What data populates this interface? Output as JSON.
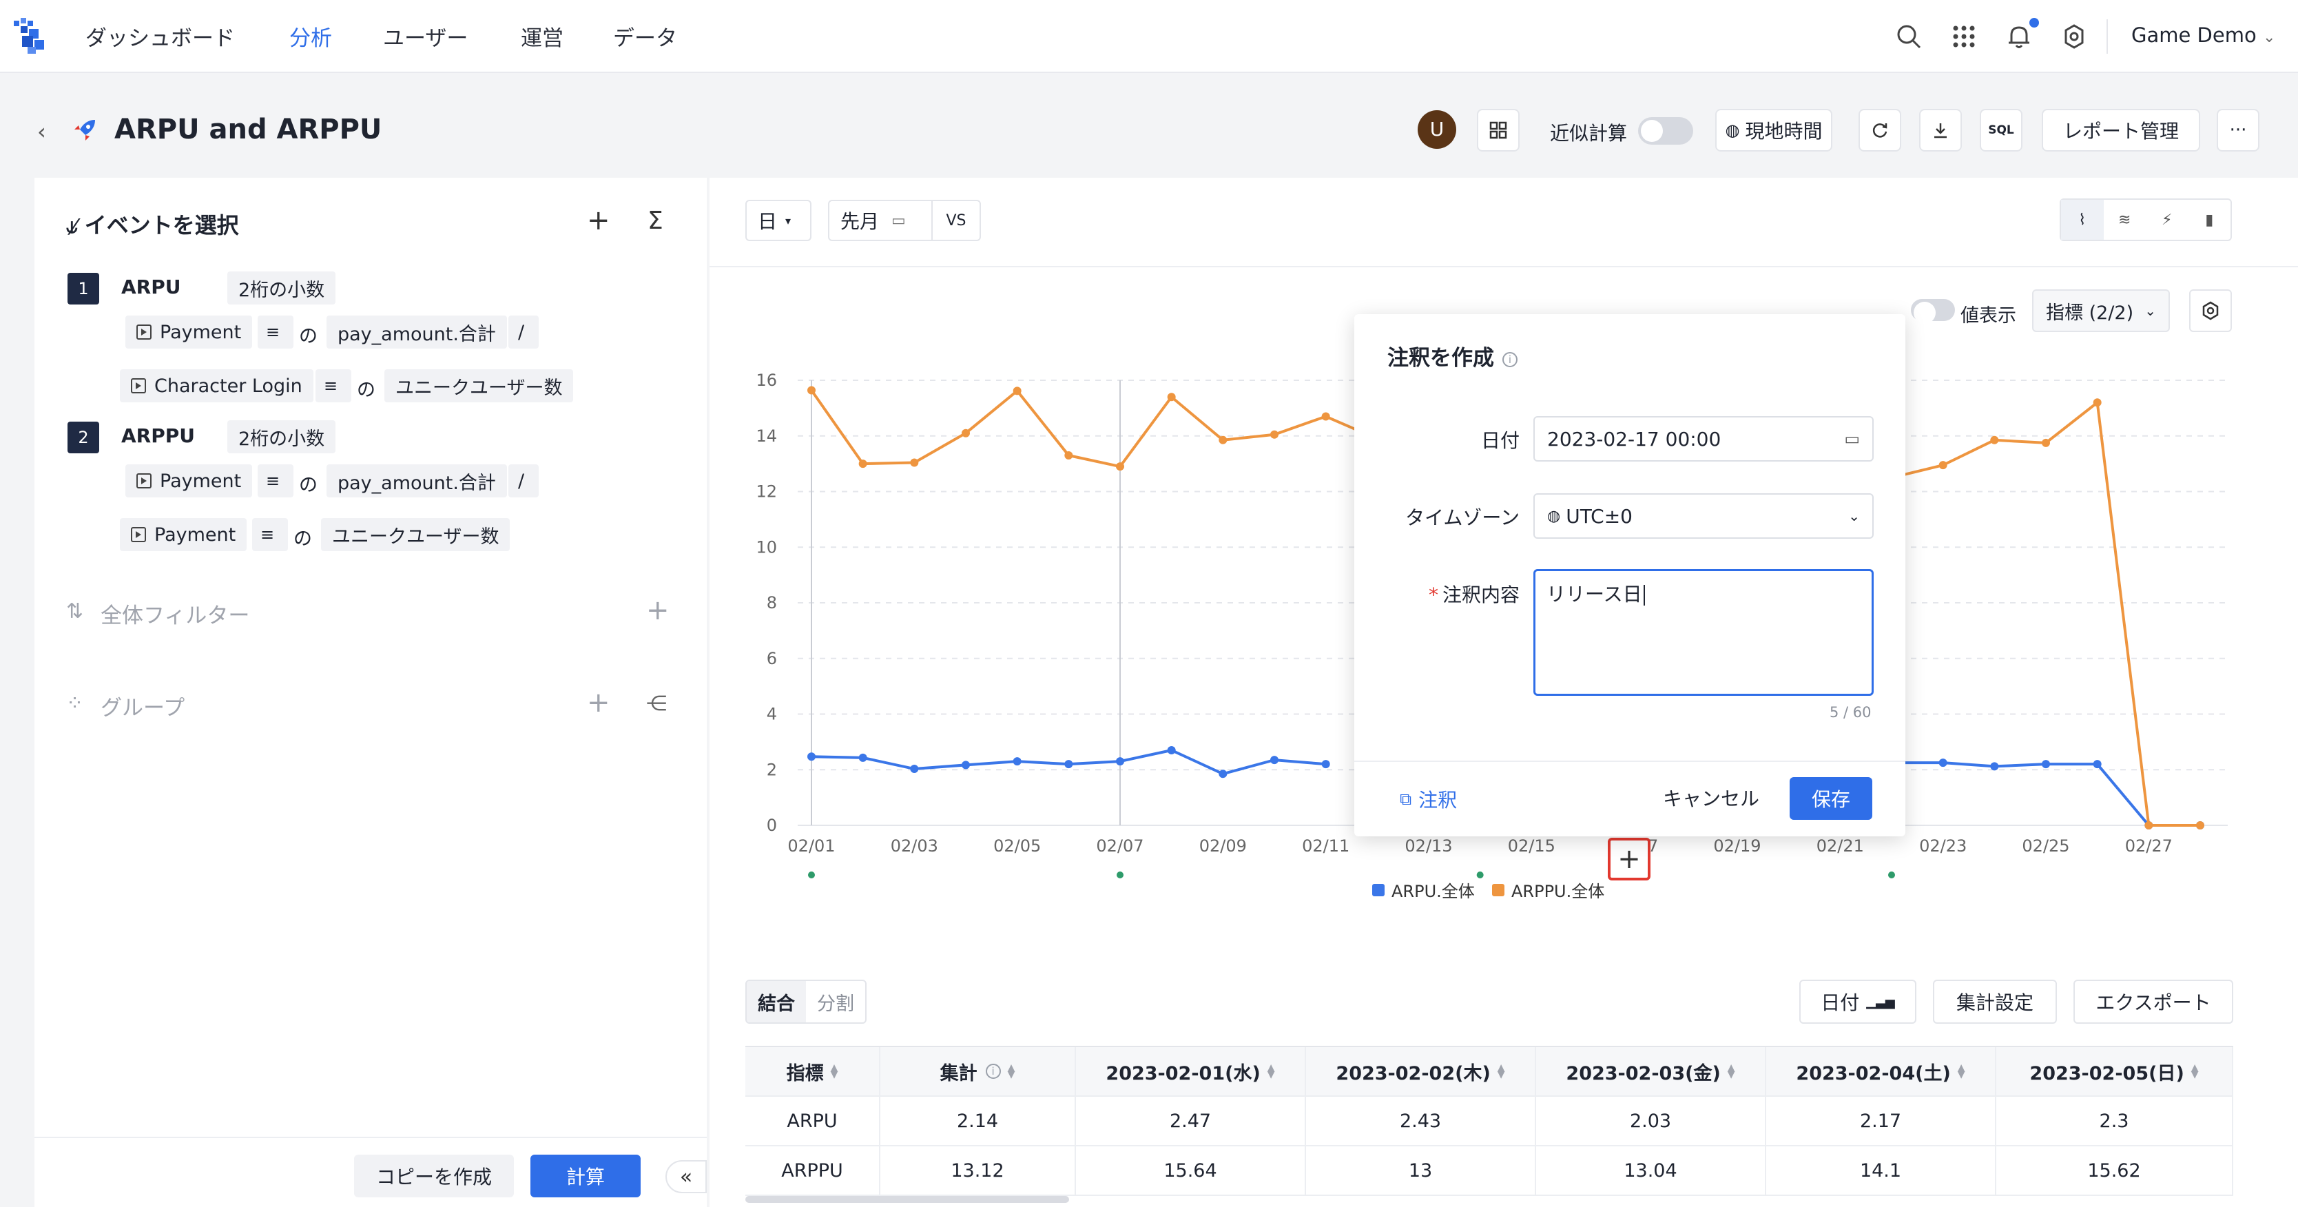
{
  "nav": {
    "items": [
      "ダッシュボード",
      "分析",
      "ユーザー",
      "運営",
      "データ"
    ],
    "active_index": 1,
    "project": "Game Demo"
  },
  "header": {
    "title": "ARPU and ARPPU",
    "avatar_letter": "U",
    "approx_label": "近似計算",
    "local_time": "現地時間",
    "sql": "SQL",
    "report_mgmt": "レポート管理",
    "more": "···"
  },
  "left": {
    "title": "イベントを選択",
    "metrics": [
      {
        "index": "1",
        "name": "ARPU",
        "decimal": "2桁の小数",
        "line1": {
          "event": "Payment",
          "no": "の",
          "prop": "pay_amount.合計",
          "op": "/"
        },
        "line2": {
          "event": "Character Login",
          "no": "の",
          "prop": "ユニークユーザー数"
        }
      },
      {
        "index": "2",
        "name": "ARPPU",
        "decimal": "2桁の小数",
        "line1": {
          "event": "Payment",
          "no": "の",
          "prop": "pay_amount.合計",
          "op": "/"
        },
        "line2": {
          "event": "Payment",
          "no": "の",
          "prop": "ユニークユーザー数"
        }
      }
    ],
    "global_filter": "全体フィルター",
    "group": "グループ",
    "copy_btn": "コピーを作成",
    "calc_btn": "計算",
    "collapse": "«"
  },
  "toolbar": {
    "granularity": "日",
    "period": "先月",
    "vs": "VS",
    "value_display": "値表示",
    "metric_select": "指標 (2/2)"
  },
  "chart_data": {
    "type": "line",
    "x": [
      "02/01",
      "02/02",
      "02/03",
      "02/04",
      "02/05",
      "02/06",
      "02/07",
      "02/08",
      "02/09",
      "02/10",
      "02/11",
      "02/12",
      "02/13",
      "02/14",
      "02/15",
      "02/16",
      "02/17",
      "02/18",
      "02/19",
      "02/20",
      "02/21",
      "02/22",
      "02/23",
      "02/24",
      "02/25",
      "02/26",
      "02/27",
      "02/28"
    ],
    "x_tick_labels": [
      "02/01",
      "02/03",
      "02/05",
      "02/07",
      "02/09",
      "02/11",
      "02/13",
      "02/15",
      "02/17",
      "02/19",
      "02/21",
      "02/23",
      "02/25",
      "02/27"
    ],
    "ylim": [
      0,
      16
    ],
    "y_ticks": [
      "0",
      "2",
      "4",
      "6",
      "8",
      "10",
      "12",
      "14",
      "16"
    ],
    "series": [
      {
        "name": "ARPU.全体",
        "color": "#3a76e8",
        "values": [
          2.47,
          2.43,
          2.03,
          2.17,
          2.3,
          2.2,
          2.3,
          2.7,
          1.85,
          2.35,
          2.2,
          null,
          null,
          null,
          null,
          null,
          null,
          null,
          null,
          null,
          null,
          2.25,
          2.25,
          2.12,
          2.2,
          2.2,
          0,
          0
        ]
      },
      {
        "name": "ARPPU.全体",
        "color": "#ee953f",
        "values": [
          15.64,
          13,
          13.04,
          14.1,
          15.62,
          13.3,
          12.9,
          15.4,
          13.85,
          14.05,
          14.7,
          13.9,
          null,
          null,
          null,
          null,
          null,
          null,
          null,
          null,
          null,
          12.5,
          12.95,
          13.85,
          13.75,
          15.2,
          0,
          0
        ]
      }
    ],
    "grid": "horizontal-dashed",
    "legend": "bottom-center"
  },
  "modal": {
    "title": "注釈を作成",
    "date_label": "日付",
    "date_value": "2023-02-17 00:00",
    "tz_label": "タイムゾーン",
    "tz_value": "UTC±0",
    "content_label": "注釈内容",
    "content_value": "リリース日",
    "counter": "5 / 60",
    "link": "注釈",
    "cancel": "キャンセル",
    "save": "保存"
  },
  "table": {
    "tabs": [
      "結合",
      "分割"
    ],
    "date_btn": "日付",
    "agg_btn": "集計設定",
    "export_btn": "エクスポート",
    "headers": [
      "指標",
      "集計",
      "2023-02-01(水)",
      "2023-02-02(木)",
      "2023-02-03(金)",
      "2023-02-04(土)",
      "2023-02-05(日)"
    ],
    "rows": [
      [
        "ARPU",
        "2.14",
        "2.47",
        "2.43",
        "2.03",
        "2.17",
        "2.3"
      ],
      [
        "ARPPU",
        "13.12",
        "15.64",
        "13",
        "13.04",
        "14.1",
        "15.62"
      ]
    ]
  },
  "colors": {
    "accent": "#2f6ee8",
    "arpu": "#3a76e8",
    "arppu": "#ee953f",
    "marker": "#e2382f"
  }
}
